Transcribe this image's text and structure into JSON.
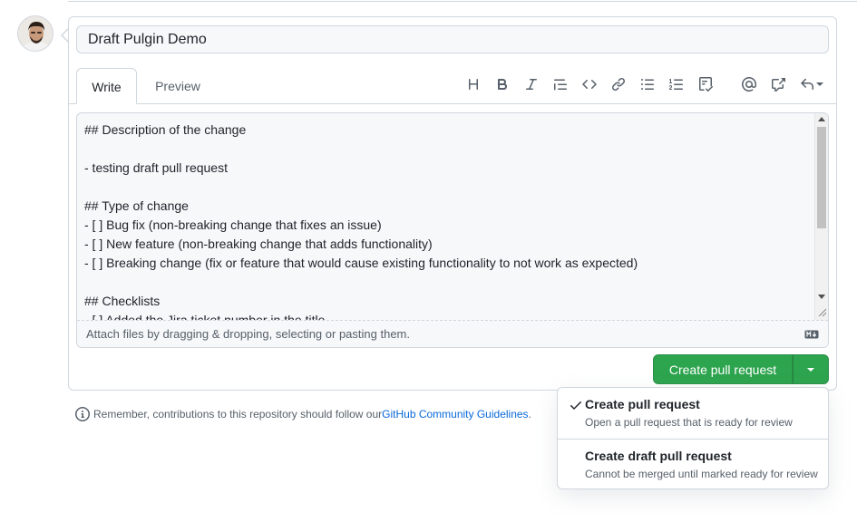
{
  "pr_form": {
    "title_value": "Draft Pulgin Demo",
    "tabs": [
      {
        "label": "Write",
        "active": true
      },
      {
        "label": "Preview",
        "active": false
      }
    ],
    "toolbar": {
      "icons": [
        "heading-icon",
        "bold-icon",
        "italic-icon",
        "quote-icon",
        "code-icon",
        "link-icon",
        "unordered-list-icon",
        "ordered-list-icon",
        "task-list-icon",
        "mention-icon",
        "cross-reference-icon",
        "reply-icon"
      ]
    },
    "body_text": "## Description of the change\n\n- testing draft pull request\n\n## Type of change\n- [ ] Bug fix (non-breaking change that fixes an issue)\n- [ ] New feature (non-breaking change that adds functionality)\n- [ ] Breaking change (fix or feature that would cause existing functionality to not work as expected)\n\n## Checklists\n- [ ] Added the Jira ticket number in the title",
    "attach_hint": "Attach files by dragging & dropping, selecting or pasting them.",
    "submit_label": "Create pull request"
  },
  "note": {
    "prefix": "Remember, contributions to this repository should follow our ",
    "link": "GitHub Community Guidelines",
    "suffix": "."
  },
  "dropdown": {
    "items": [
      {
        "title": "Create pull request",
        "description": "Open a pull request that is ready for review",
        "selected": true
      },
      {
        "title": "Create draft pull request",
        "description": "Cannot be merged until marked ready for review",
        "selected": false
      }
    ]
  },
  "colors": {
    "primary_button": "#2da44e",
    "link": "#0969da",
    "border": "#d0d7de",
    "muted_text": "#57606a"
  }
}
